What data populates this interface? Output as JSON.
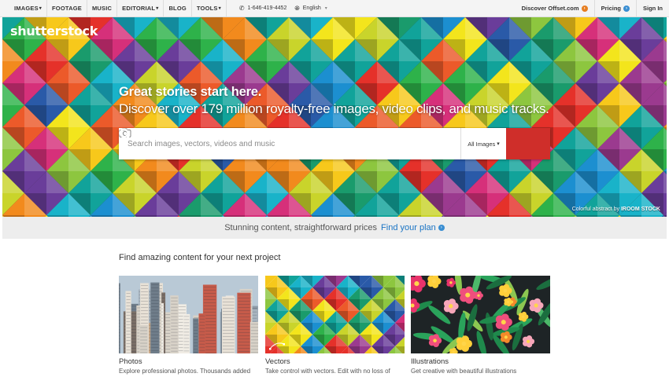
{
  "nav": {
    "items": [
      {
        "label": "IMAGES",
        "caret": true
      },
      {
        "label": "FOOTAGE",
        "caret": false
      },
      {
        "label": "MUSIC",
        "caret": false
      },
      {
        "label": "EDITORIAL",
        "caret": true
      },
      {
        "label": "BLOG",
        "caret": false
      },
      {
        "label": "TOOLS",
        "caret": true
      }
    ],
    "phone": "1-646-419-4452",
    "language": "English",
    "offset_link": "Discover Offset.com",
    "pricing": "Pricing",
    "sign_in": "Sign In"
  },
  "hero": {
    "logo": "shutterstock",
    "title": "Great stories start here.",
    "subtitle": "Discover over 179 million royalty-free images, video clips, and music tracks.",
    "search_placeholder": "Search images, vectors, videos and music",
    "search_category": "All Images",
    "credit_prefix": "Colorful abstract by",
    "credit_author": "IROOM STOCK"
  },
  "banner": {
    "text": "Stunning content, straightforward prices",
    "link": "Find your plan"
  },
  "content": {
    "section_title": "Find amazing content for your next project",
    "cards": [
      {
        "title": "Photos",
        "desc": "Explore professional photos. Thousands added"
      },
      {
        "title": "Vectors",
        "desc": "Take control with vectors. Edit with no loss of"
      },
      {
        "title": "Illustrations",
        "desc": "Get creative with beautiful illustrations"
      }
    ]
  },
  "colors": {
    "accent_red": "#cf2e2a",
    "link_blue": "#1a74c4",
    "offset_orange": "#e67e22"
  }
}
